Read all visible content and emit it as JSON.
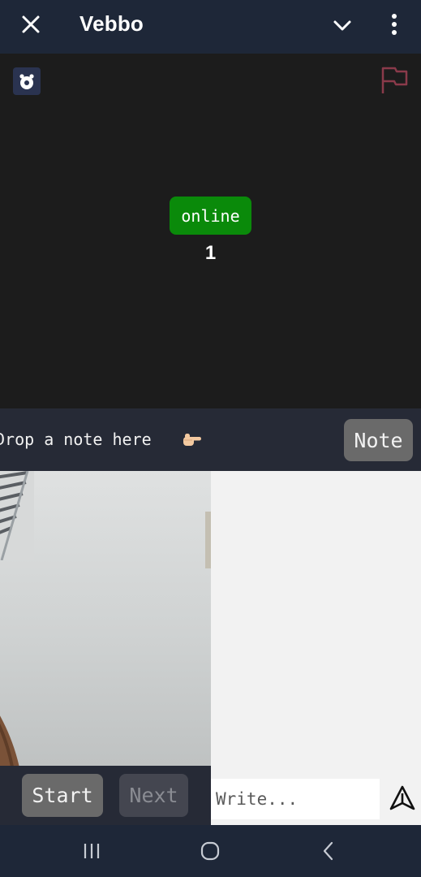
{
  "app_bar": {
    "title": "Vebbo",
    "icons": [
      "close-icon",
      "chevron-down-icon",
      "more-vert-icon"
    ]
  },
  "stage": {
    "status_badge": "online",
    "online_count": "1",
    "icons": [
      "bot-icon",
      "flag-icon"
    ],
    "colors": {
      "background": "#1c1c1c",
      "badge": "#0a8a0a",
      "flag": "#8a3a4a"
    }
  },
  "note_bar": {
    "text": "Drop a note here",
    "note_button": "Note",
    "icons": [
      "pointing-hand-icon"
    ]
  },
  "controls": {
    "start_label": "Start",
    "next_label": "Next"
  },
  "composer": {
    "placeholder": "Write...",
    "icons": [
      "send-icon"
    ]
  },
  "system_nav": {
    "icons": [
      "recents-icon",
      "home-icon",
      "back-icon"
    ]
  }
}
